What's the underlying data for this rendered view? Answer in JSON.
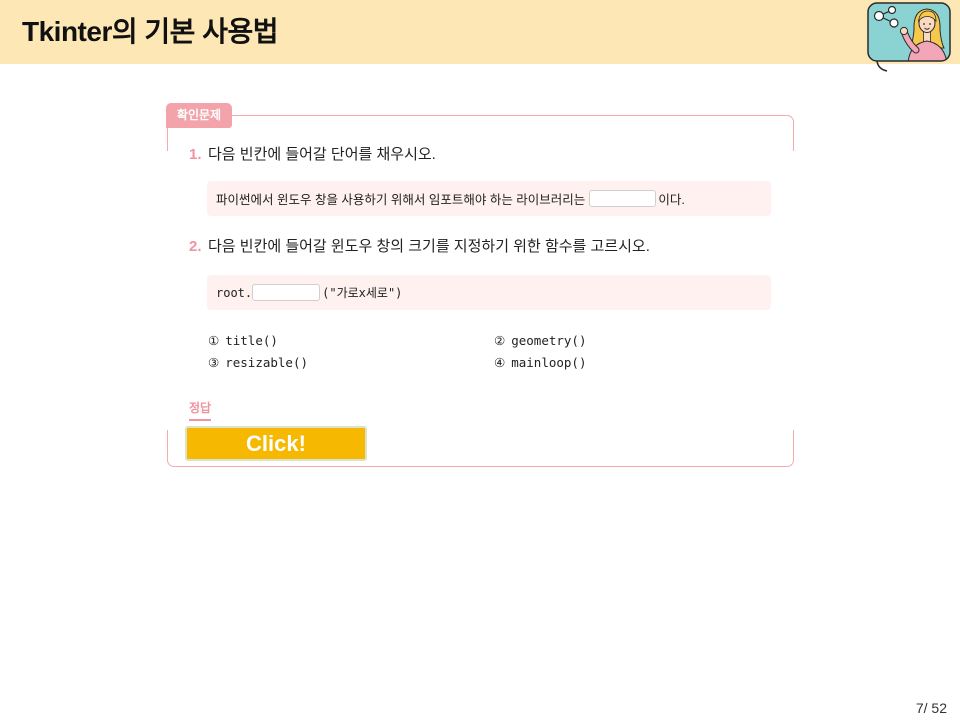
{
  "header": {
    "title": "Tkinter의 기본 사용법",
    "illustration_icon": "teacher-network-icon"
  },
  "quiz": {
    "tab_label": "확인문제",
    "questions": [
      {
        "number": "1.",
        "text": "다음 빈칸에 들어갈 단어를 채우시오.",
        "sentence_before": "파이썬에서 윈도우 창을 사용하기 위해서 임포트해야 하는 라이브러리는",
        "sentence_after": "이다."
      },
      {
        "number": "2.",
        "text": "다음 빈칸에 들어갈 윈도우 창의 크기를 지정하기 위한 함수를 고르시오.",
        "code_before": "root.",
        "code_after": "(\"가로x세로\")",
        "options": [
          {
            "marker": "①",
            "label": "title()"
          },
          {
            "marker": "②",
            "label": "geometry()"
          },
          {
            "marker": "③",
            "label": "resizable()"
          },
          {
            "marker": "④",
            "label": "mainloop()"
          }
        ]
      }
    ],
    "answer_label": "정답",
    "reveal_button_label": "Click!"
  },
  "footer": {
    "page_number": "7/ 52"
  },
  "theme": {
    "header-bg": "#FDE8B5",
    "accent-pink": "#F0939D",
    "tab-pink": "#F3A3AA",
    "frame-pink": "#F2ABB0",
    "box-bg": "#FEF1F0",
    "button-bg": "#F6B800",
    "button-border": "#DCE3C8",
    "text": "#222222"
  }
}
